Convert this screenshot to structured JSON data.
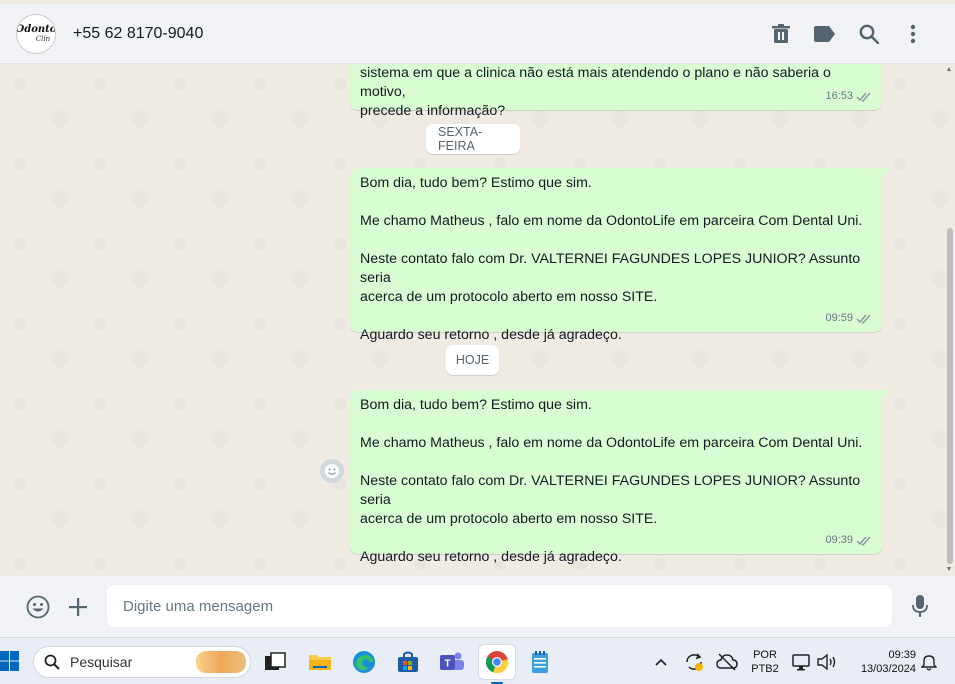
{
  "header": {
    "avatar_logo_top": "Odonto",
    "avatar_logo_bottom": "Clin",
    "contact": "+55 62 8170-9040",
    "icons": [
      "delete-icon",
      "label-icon",
      "search-icon",
      "more-vert-icon"
    ]
  },
  "messages": [
    {
      "text": "sistema em que a clinica não está mais atendendo o plano e não saberia o motivo,\nprecede a informação?",
      "time": "16:53",
      "status": "read"
    },
    {
      "text": "Bom dia, tudo bem? Estimo que sim.\n\nMe chamo Matheus , falo em nome da OdontoLife em parceira Com Dental Uni.\n\nNeste contato falo com Dr. VALTERNEI FAGUNDES LOPES JUNIOR? Assunto seria\nacerca de um protocolo aberto em nosso SITE.\n\nAguardo seu retorno , desde já agradeço.",
      "time": "09:59",
      "status": "read"
    },
    {
      "text": "Bom dia, tudo bem? Estimo que sim.\n\nMe chamo Matheus , falo em nome da OdontoLife em parceira Com Dental Uni.\n\nNeste contato falo com Dr. VALTERNEI FAGUNDES LOPES JUNIOR? Assunto seria\nacerca de um protocolo aberto em nosso SITE.\n\nAguardo seu retorno , desde já agradeço.",
      "time": "09:39",
      "status": "read"
    }
  ],
  "dates": {
    "friday": "SEXTA-FEIRA",
    "today": "HOJE"
  },
  "composer": {
    "placeholder": "Digite uma mensagem"
  },
  "taskbar": {
    "search_label": "Pesquisar",
    "lang_line1": "POR",
    "lang_line2": "PTB2",
    "time": "09:39",
    "date": "13/03/2024"
  },
  "colors": {
    "outgoing_bubble": "#d9fdd3",
    "chat_bg": "#efeae2",
    "header_bg": "#f0f2f5",
    "tick_read": "#53bdeb"
  }
}
